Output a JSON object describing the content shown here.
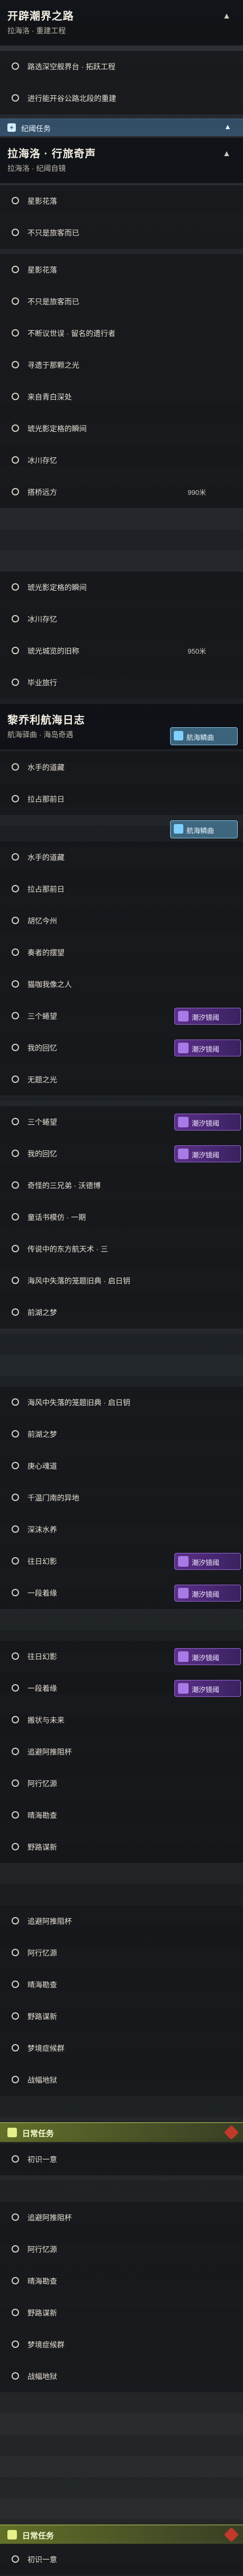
{
  "quests": {
    "s1": {
      "title": "开辟潮界之路",
      "subtitle": "拉海洛 · 重建工程",
      "chev": "▲",
      "rows": [
        "路选深空舰界台 · 拓跃工程",
        "进行能开谷公路北段的重建"
      ]
    },
    "tag1": {
      "label": "纪阈任务",
      "chev": "▲"
    },
    "s2": {
      "title": "拉海洛 · 行旅奇声",
      "subtitle": "拉海洛 · 纪阈自镜",
      "chev": "▲",
      "rows": [
        "星影花落",
        "不只是旅客而已"
      ]
    },
    "block2": {
      "rows": [
        {
          "label": "星影花落"
        },
        {
          "label": "不只是旅客而已"
        },
        {
          "label": "不断议世误 · 留名的遗行者"
        },
        {
          "label": "寻遗于那颗之光"
        },
        {
          "label": "来自青白深处"
        },
        {
          "label": "琥光影定格的瞬间"
        },
        {
          "label": "冰川存忆"
        },
        {
          "label": "搭桥远方",
          "dist": "990米"
        }
      ]
    },
    "block3": {
      "rows": [
        {
          "label": "琥光影定格的瞬间"
        },
        {
          "label": "冰川存忆"
        },
        {
          "label": "琥光城览的旧称",
          "dist": "950米"
        },
        {
          "label": "毕业旅行"
        }
      ]
    },
    "s3": {
      "title": "黎乔利航海日志",
      "subtitle": "航海驿曲 · 海岛奇遇",
      "pill": "航海鳞曲",
      "rows": [
        "水手的道藏",
        "拉占那前日"
      ]
    },
    "pill2": "航海鳞曲",
    "block4": {
      "rows": [
        {
          "label": "水手的道藏"
        },
        {
          "label": "拉占那前日"
        },
        {
          "label": "胡忆今州"
        },
        {
          "label": "奏者的摆望"
        },
        {
          "label": "猫咖我像之人"
        },
        {
          "label": "三个蜷望",
          "badge": "潮汐镜阈"
        },
        {
          "label": "我的回忆",
          "badge": "潮汐镜阈"
        },
        {
          "label": "无题之光"
        }
      ]
    },
    "block5": {
      "rows": [
        {
          "label": "三个蜷望",
          "badge": "潮汐镜阈"
        },
        {
          "label": "我的回忆",
          "badge": "潮汐镜阈"
        },
        {
          "label": "奇怪的三兄弟 · 沃德博"
        },
        {
          "label": "童话书模仿 · 一期"
        },
        {
          "label": "传说中的东方航天术 · 三"
        },
        {
          "label": "海风中失落的笼题旧典 · 启日钥"
        },
        {
          "label": "前湖之梦"
        }
      ]
    },
    "block6": {
      "rows": [
        {
          "label": "海风中失落的笼题旧典 · 启日钥"
        },
        {
          "label": "前湖之梦"
        },
        {
          "label": "庚心魂道"
        },
        {
          "label": "千温门南的异地"
        },
        {
          "label": "深沫水养"
        },
        {
          "label": "往日幻影",
          "badge": "潮汐镜阈"
        },
        {
          "label": "一段着缘",
          "badge": "潮汐镜阈"
        }
      ]
    },
    "block7": {
      "rows": [
        {
          "label": "往日幻影",
          "badge": "潮汐镜阈"
        },
        {
          "label": "一段着缘",
          "badge": "潮汐镜阈"
        },
        {
          "label": "搬状与未来"
        },
        {
          "label": "追避阿推阻杯"
        },
        {
          "label": "阿行忆源"
        },
        {
          "label": "晴海勘查"
        },
        {
          "label": "野路谋新"
        }
      ]
    },
    "block8": {
      "rows": [
        {
          "label": "追避阿推阻杯"
        },
        {
          "label": "阿行忆源"
        },
        {
          "label": "晴海勘查"
        },
        {
          "label": "野路谋新"
        },
        {
          "label": "梦境症候群"
        },
        {
          "label": "战幅地狱"
        }
      ]
    },
    "daily1": "日常任务",
    "d1rows": [
      {
        "label": "初识一意"
      }
    ],
    "block9": {
      "rows": [
        {
          "label": "追避阿推阻杯"
        },
        {
          "label": "阿行忆源"
        },
        {
          "label": "晴海勘查"
        },
        {
          "label": "野路谋新"
        },
        {
          "label": "梦境症候群"
        },
        {
          "label": "战幅地狱"
        }
      ]
    },
    "daily2": "日常任务",
    "d2rows": [
      {
        "label": "初识一意"
      }
    ]
  }
}
